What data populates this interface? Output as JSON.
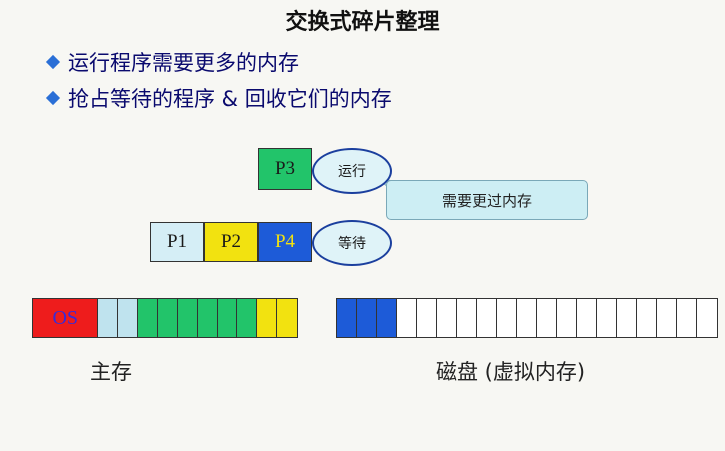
{
  "title": "交换式碎片整理",
  "bullets": [
    "运行程序需要更多的内存",
    "抢占等待的程序 & 回收它们的内存"
  ],
  "processes": {
    "p3": {
      "label": "P3",
      "state": "运行",
      "color": "#22c46a"
    },
    "p1": {
      "label": "P1",
      "color": "#d5eef6"
    },
    "p2": {
      "label": "P2",
      "color": "#f2e210"
    },
    "p4": {
      "label": "P4",
      "state": "等待",
      "color": "#1d5bd8"
    }
  },
  "callout_text": "需要更过内存",
  "memory": {
    "label": "主存",
    "os_label": "OS",
    "cells": [
      {
        "kind": "os",
        "color": "#ee1c1c"
      },
      {
        "kind": "p1",
        "color": "#bfe3ee"
      },
      {
        "kind": "p1",
        "color": "#bfe3ee"
      },
      {
        "kind": "p3",
        "color": "#22c46a"
      },
      {
        "kind": "p3",
        "color": "#22c46a"
      },
      {
        "kind": "p3",
        "color": "#22c46a"
      },
      {
        "kind": "p3",
        "color": "#22c46a"
      },
      {
        "kind": "p3",
        "color": "#22c46a"
      },
      {
        "kind": "p3",
        "color": "#22c46a"
      },
      {
        "kind": "p2",
        "color": "#f2e210"
      },
      {
        "kind": "p2",
        "color": "#f2e210"
      }
    ]
  },
  "disk": {
    "label": "磁盘 (虚拟内存)",
    "cells": [
      {
        "kind": "p4",
        "color": "#1d5bd8"
      },
      {
        "kind": "p4",
        "color": "#1d5bd8"
      },
      {
        "kind": "p4",
        "color": "#1d5bd8"
      },
      {
        "kind": "free",
        "color": "#ffffff"
      },
      {
        "kind": "free",
        "color": "#ffffff"
      },
      {
        "kind": "free",
        "color": "#ffffff"
      },
      {
        "kind": "free",
        "color": "#ffffff"
      },
      {
        "kind": "free",
        "color": "#ffffff"
      },
      {
        "kind": "free",
        "color": "#ffffff"
      },
      {
        "kind": "free",
        "color": "#ffffff"
      },
      {
        "kind": "free",
        "color": "#ffffff"
      },
      {
        "kind": "free",
        "color": "#ffffff"
      },
      {
        "kind": "free",
        "color": "#ffffff"
      },
      {
        "kind": "free",
        "color": "#ffffff"
      },
      {
        "kind": "free",
        "color": "#ffffff"
      },
      {
        "kind": "free",
        "color": "#ffffff"
      },
      {
        "kind": "free",
        "color": "#ffffff"
      },
      {
        "kind": "free",
        "color": "#ffffff"
      },
      {
        "kind": "free",
        "color": "#ffffff"
      }
    ]
  }
}
